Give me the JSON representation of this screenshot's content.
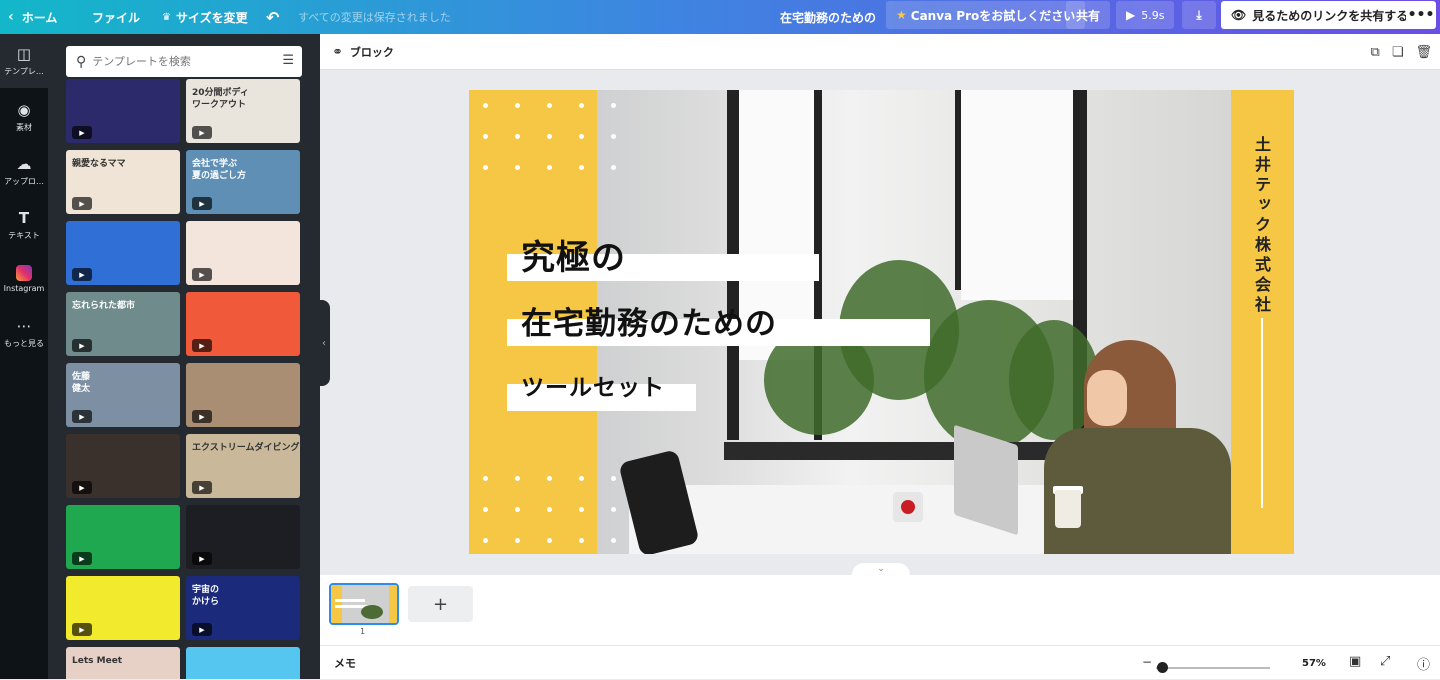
{
  "topbar": {
    "home_label": "ホーム",
    "file_label": "ファイル",
    "resize_label": "サイズを変更",
    "saved_status": "すべての変更は保存されました",
    "doc_title": "在宅勤務のための",
    "pro_label": "Canva Proをお試しください",
    "share_label": "共有",
    "play_duration": "5.9s",
    "view_link_label": "見るためのリンクを共有する",
    "more_label": "•••"
  },
  "sidenav": {
    "items": [
      {
        "label": "テンプレ…",
        "icon": "template-icon"
      },
      {
        "label": "素材",
        "icon": "elements-icon"
      },
      {
        "label": "アップロ…",
        "icon": "upload-icon"
      },
      {
        "label": "テキスト",
        "icon": "text-icon"
      },
      {
        "label": "Instagram",
        "icon": "instagram-icon"
      },
      {
        "label": "もっと見る",
        "icon": "more-icon"
      }
    ]
  },
  "panel": {
    "search_placeholder": "テンプレートを検索",
    "thumbnails": [
      {
        "text": "",
        "bg": "#2c2a6b"
      },
      {
        "text": "20分間ボディ\nワークアウト",
        "bg": "#e9e4dc"
      },
      {
        "text": "親愛なるママ",
        "bg": "#efe4d6"
      },
      {
        "text": "会社で学ぶ\n夏の過ごし方",
        "bg": "#5f8fb4"
      },
      {
        "text": "",
        "bg": "#2f6fd6"
      },
      {
        "text": "",
        "bg": "#f4e5dc"
      },
      {
        "text": "忘れられた都市",
        "bg": "#6f8b8c"
      },
      {
        "text": "",
        "bg": "#f05a3a"
      },
      {
        "text": "佐藤\n健太",
        "bg": "#7c8fa3"
      },
      {
        "text": "",
        "bg": "#a98e74"
      },
      {
        "text": "",
        "bg": "#3a302c"
      },
      {
        "text": "エクストリームダイビング",
        "bg": "#c9b89a"
      },
      {
        "text": "",
        "bg": "#1fa84f"
      },
      {
        "text": "",
        "bg": "#1d1d24"
      },
      {
        "text": "",
        "bg": "#f2ea2c"
      },
      {
        "text": "宇宙の\nかけら",
        "bg": "#1b2a7a"
      },
      {
        "text": "Lets Meet",
        "bg": "#e7d1c6"
      },
      {
        "text": "",
        "bg": "#54c6f0"
      }
    ]
  },
  "editor": {
    "block_label": "ブロック"
  },
  "design": {
    "title_line1": "究極の",
    "title_line2": "在宅勤務のための",
    "title_line3": "ツールセット",
    "company": "土井テック株式会社"
  },
  "pages": {
    "current_page_number": "1",
    "add_label": "+"
  },
  "bottom": {
    "memo_label": "メモ",
    "zoom_value": "57%",
    "zoom_level": 0.05
  },
  "colors": {
    "accent_yellow": "#f6c744",
    "topbar_start": "#13b7c9",
    "topbar_end": "#6a4ee6",
    "selection_blue": "#2d8cf0"
  }
}
